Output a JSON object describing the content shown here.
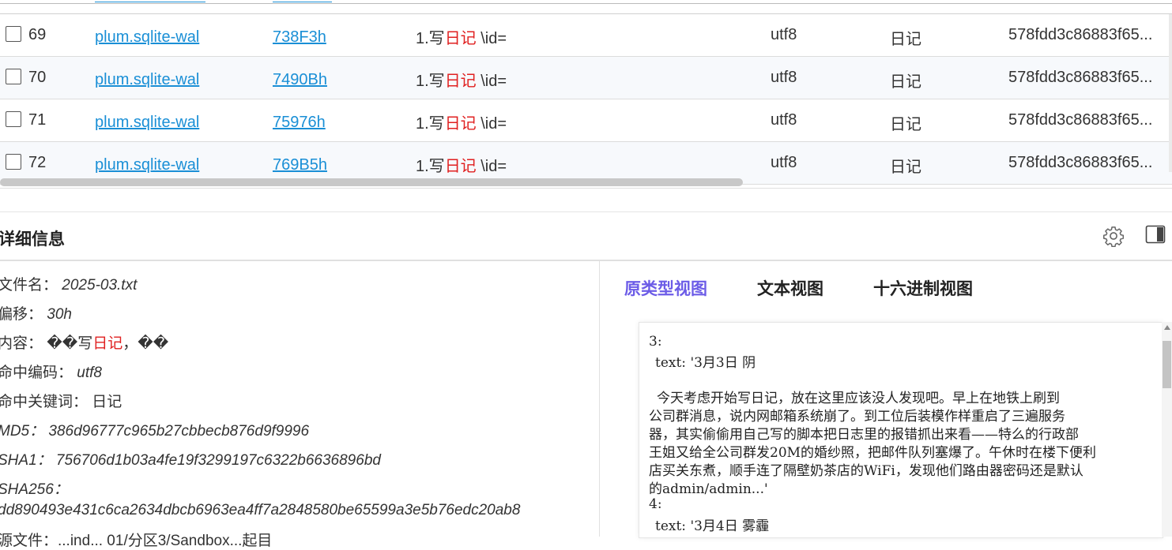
{
  "table": {
    "rows": [
      {
        "index": "69",
        "file": "plum.sqlite-wal",
        "offset": "738F3h",
        "content_pre": "1.写",
        "content_kw": "日记",
        "content_post": " \\id=",
        "encoding": "utf8",
        "keyword": "日记",
        "hash": "578fdd3c86883f65..."
      },
      {
        "index": "70",
        "file": "plum.sqlite-wal",
        "offset": "7490Bh",
        "content_pre": "1.写",
        "content_kw": "日记",
        "content_post": " \\id=",
        "encoding": "utf8",
        "keyword": "日记",
        "hash": "578fdd3c86883f65..."
      },
      {
        "index": "71",
        "file": "plum.sqlite-wal",
        "offset": "75976h",
        "content_pre": "1.写",
        "content_kw": "日记",
        "content_post": " \\id=",
        "encoding": "utf8",
        "keyword": "日记",
        "hash": "578fdd3c86883f65..."
      },
      {
        "index": "72",
        "file": "plum.sqlite-wal",
        "offset": "769B5h",
        "content_pre": "1.写",
        "content_kw": "日记",
        "content_post": " \\id=",
        "encoding": "utf8",
        "keyword": "日记",
        "hash": "578fdd3c86883f65..."
      }
    ]
  },
  "detail": {
    "title": "详细信息",
    "filename_label": "文件名：",
    "filename": "2025-03.txt",
    "offset_label": "偏移：",
    "offset": "30h",
    "content_label": "内容：",
    "content_pre": "��写",
    "content_kw": "日记",
    "content_post": "，��",
    "encoding_label": "命中编码：",
    "encoding": "utf8",
    "keyword_label": "命中关键词：",
    "keyword": "日记",
    "md5_label": "MD5：",
    "md5": "386d96777c965b27cbbecb876d9f9996",
    "sha1_label": "SHA1：",
    "sha1": "756706d1b03a4fe19f3299197c6322b6636896bd",
    "sha256_label": "SHA256：",
    "sha256": "dd890493e431c6ca2634dbcb6963ea4ff7a2848580be65599a3e5b76edc20ab8",
    "source_partial": "源文件：...ind... 01/分区3/Sandbox...起目"
  },
  "tabs": {
    "prototype": "原类型视图",
    "text": "文本视图",
    "hex": "十六进制视图"
  },
  "viewer": {
    "lines": [
      "3:",
      "  text: '3月3日 阴",
      "",
      "     今天考虑开始写日记，放在这里应该没人发现吧。早上在地铁上刷到",
      "公司群消息，说内网邮箱系统崩了。到工位后装模作样重启了三遍服务",
      "器，其实偷偷用自己写的脚本把日志里的报错抓出来看——特么的行政部",
      "王姐又给全公司群发20M的婚纱照，把邮件队列塞爆了。午休时在楼下便利",
      "店买关东煮，顺手连了隔壁奶茶店的WiFi，发现他们路由器密码还是默认",
      "的admin/admin...'",
      "4:",
      "  text: '3月4日 雾霾"
    ]
  }
}
